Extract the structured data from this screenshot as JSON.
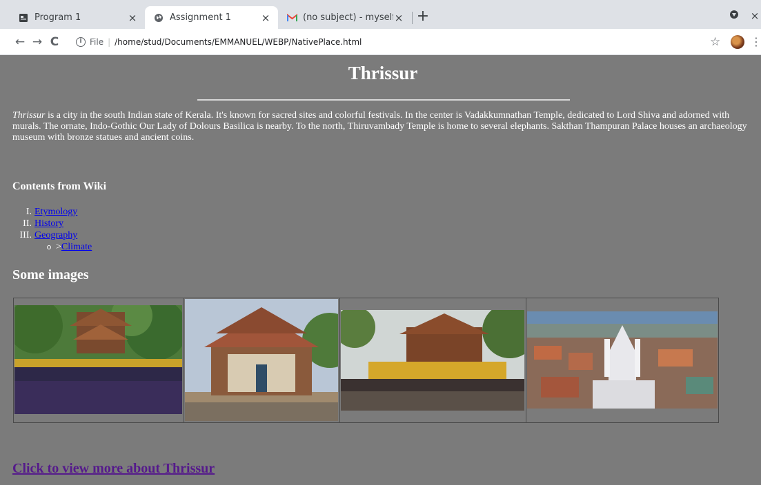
{
  "browser": {
    "tabs": [
      {
        "title": "Program 1",
        "active": false
      },
      {
        "title": "Assignment 1",
        "active": true
      },
      {
        "title": "(no subject) - myself.emm",
        "active": false
      }
    ],
    "address": {
      "scheme_label": "File",
      "path": "/home/stud/Documents/EMMANUEL/WEBP/NativePlace.html"
    }
  },
  "page": {
    "title": "Thrissur",
    "intro_italic": "Thrissur",
    "intro_rest": " is a city in the south Indian state of Kerala. It's known for sacred sites and colorful festivals. In the center is Vadakkumnathan Temple, dedicated to Lord Shiva and adorned with murals. The ornate, Indo-Gothic Our Lady of Dolours Basilica is nearby. To the north, Thiruvambady Temple is home to several elephants. Sakthan Thampuran Palace houses an archaeology museum with bronze statues and ancient coins.",
    "contents_heading": "Contents from Wiki",
    "toc": [
      {
        "num": "I.",
        "label": "Etymology"
      },
      {
        "num": "II.",
        "label": "History"
      },
      {
        "num": "III.",
        "label": "Geography"
      }
    ],
    "toc_sub_prefix": ">",
    "toc_sub_label": "Climate",
    "images_heading": "Some images",
    "more_link": "Click to view more about Thrissur"
  },
  "colors": {
    "page_bg": "#7b7b7b",
    "link": "#0000ee",
    "visited_link": "#551a8b",
    "tab_strip": "#dee1e6"
  }
}
